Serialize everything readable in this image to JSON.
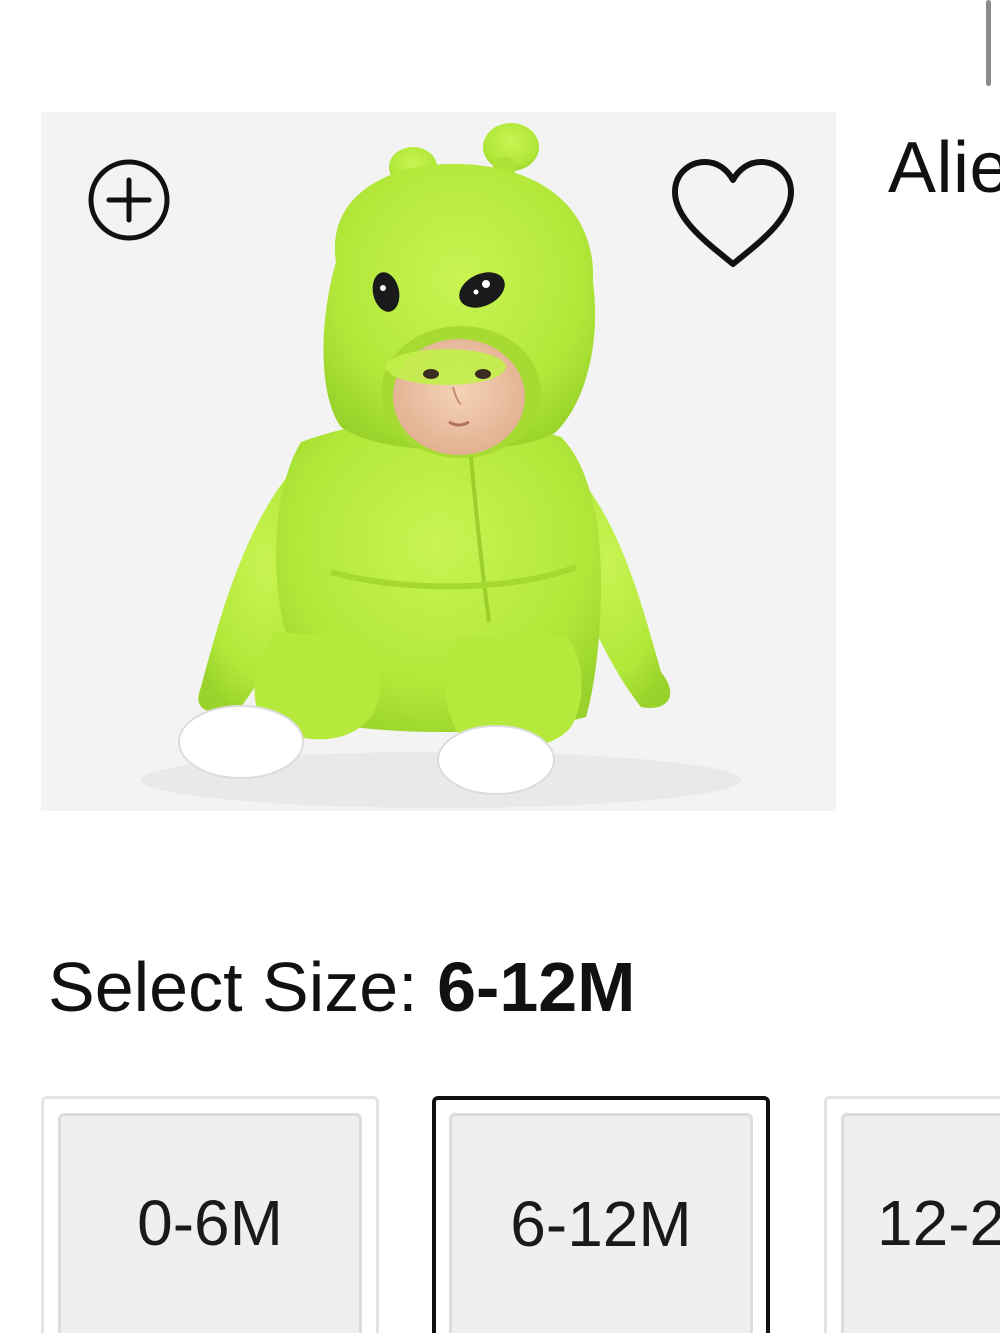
{
  "product": {
    "title": "Alie",
    "image_alt": "Baby in green alien costume"
  },
  "actions": {
    "zoom_icon": "plus-circle-icon",
    "favorite_icon": "heart-outline-icon"
  },
  "size_selector": {
    "label": "Select Size:",
    "selected_value": "6-12M",
    "options": [
      {
        "label": "0-6M",
        "selected": false
      },
      {
        "label": "6-12M",
        "selected": true
      },
      {
        "label": "12-2",
        "selected": false
      }
    ]
  },
  "colors": {
    "costume_green": "#b5ea3c",
    "image_background": "#f3f3f4",
    "selected_border": "#111111"
  }
}
